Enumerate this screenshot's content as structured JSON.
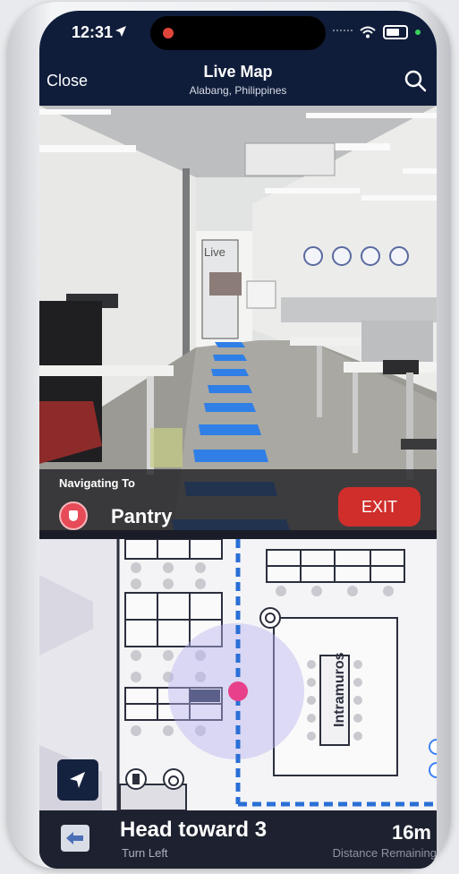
{
  "status_bar": {
    "time": "12:31"
  },
  "header": {
    "close_label": "Close",
    "title": "Live Map",
    "subtitle": "Alabang, Philippines"
  },
  "camera": {
    "sign_text": "Live"
  },
  "navigation": {
    "label": "Navigating To",
    "destination": "Pantry",
    "exit_label": "EXIT"
  },
  "map": {
    "room_label": "Intramuros"
  },
  "instruction": {
    "text": "Head toward 3",
    "sub": "Turn Left",
    "distance": "16m",
    "distance_label": "Distance Remaining"
  },
  "icons": [
    "location-arrow-icon",
    "wifi-icon",
    "battery-icon",
    "search-icon",
    "pantry-icon",
    "navigate-icon",
    "turn-left-icon",
    "restroom-icon",
    "accessibility-icon",
    "poi-icon"
  ],
  "colors": {
    "header_bg": "#0f1d3a",
    "exit_red": "#cf2e2b",
    "route_blue": "#2a6fd6",
    "position_pink": "#e8408a",
    "arrow_blue": "#2f7fe6"
  }
}
